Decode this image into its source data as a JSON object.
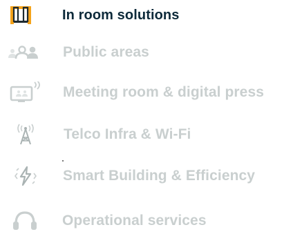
{
  "colors": {
    "active_label": "#0d2a3a",
    "inactive_label": "#c9cfcf",
    "active_icon": "#f5a31a",
    "active_icon_dark": "#1e2a30",
    "inactive_icon": "#c9cfcf"
  },
  "menu": {
    "items": [
      {
        "label": "In room solutions",
        "icon": "room-door-icon",
        "active": true
      },
      {
        "label": "Public areas",
        "icon": "people-group-icon",
        "active": false
      },
      {
        "label": "Meeting room & digital press",
        "icon": "monitor-wifi-icon",
        "active": false
      },
      {
        "label": "Telco Infra & Wi-Fi",
        "icon": "antenna-tower-icon",
        "active": false
      },
      {
        "label": "Smart Building & Efficiency",
        "icon": "lightning-energy-icon",
        "active": false
      },
      {
        "label": "Operational services",
        "icon": "headset-icon",
        "active": false
      }
    ]
  }
}
